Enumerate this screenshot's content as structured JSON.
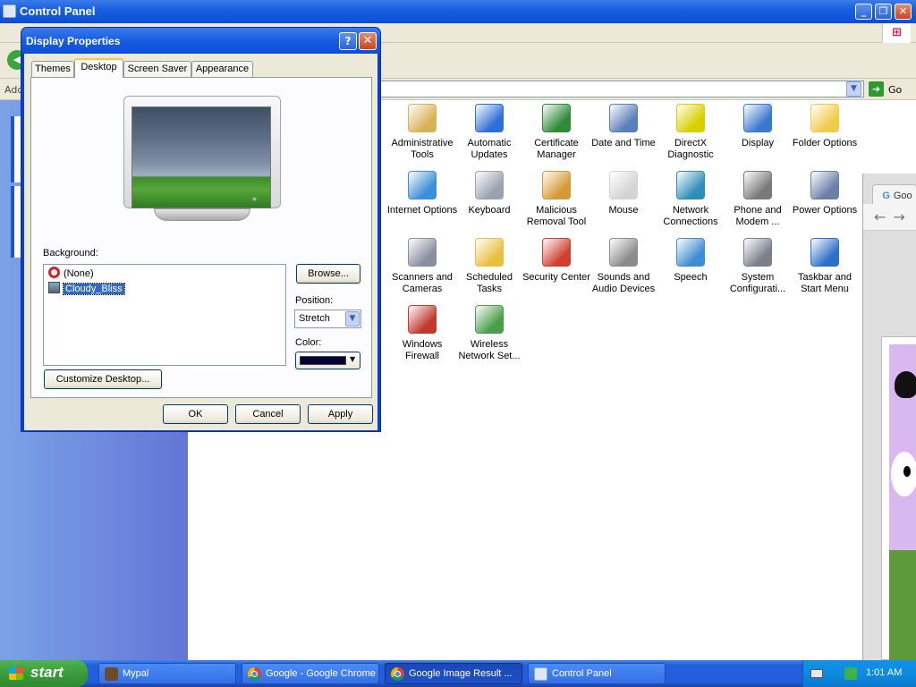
{
  "control_panel": {
    "title": "Control Panel",
    "address_label": "Add",
    "go_label": "Go",
    "items": [
      {
        "label": "Administrative Tools",
        "icon": "administrative-tools-icon",
        "color": "#d8b258"
      },
      {
        "label": "Automatic Updates",
        "icon": "automatic-updates-icon",
        "color": "#2e6fd6"
      },
      {
        "label": "Certificate Manager",
        "icon": "certificate-icon",
        "color": "#2f8a3a"
      },
      {
        "label": "Date and Time",
        "icon": "clock-icon",
        "color": "#5b7fb8"
      },
      {
        "label": "DirectX Diagnostic",
        "icon": "directx-icon",
        "color": "#d7d000"
      },
      {
        "label": "Display",
        "icon": "display-icon",
        "color": "#3a78d0"
      },
      {
        "label": "Folder Options",
        "icon": "folder-icon",
        "color": "#f0cb4c"
      },
      {
        "label": "Internet Options",
        "icon": "internet-options-icon",
        "color": "#3b8fd8"
      },
      {
        "label": "Keyboard",
        "icon": "keyboard-icon",
        "color": "#9aa2b0"
      },
      {
        "label": "Malicious Removal Tool",
        "icon": "malicious-removal-icon",
        "color": "#d59a36"
      },
      {
        "label": "Mouse",
        "icon": "mouse-icon",
        "color": "#d4d4d4"
      },
      {
        "label": "Network Connections",
        "icon": "network-icon",
        "color": "#2f8fb8"
      },
      {
        "label": "Phone and Modem ...",
        "icon": "phone-modem-icon",
        "color": "#7a7a7a"
      },
      {
        "label": "Power Options",
        "icon": "power-options-icon",
        "color": "#6b7fa8"
      },
      {
        "label": "Scanners and Cameras",
        "icon": "scanner-icon",
        "color": "#8a8fa0"
      },
      {
        "label": "Scheduled Tasks",
        "icon": "scheduled-tasks-icon",
        "color": "#e8c040"
      },
      {
        "label": "Security Center",
        "icon": "security-shield-icon",
        "color": "#d04030"
      },
      {
        "label": "Sounds and Audio Devices",
        "icon": "speaker-icon",
        "color": "#8c8c8c"
      },
      {
        "label": "Speech",
        "icon": "speech-icon",
        "color": "#3f8fd0"
      },
      {
        "label": "System Configurati...",
        "icon": "system-icon",
        "color": "#7a7f8a"
      },
      {
        "label": "Taskbar and Start Menu",
        "icon": "taskbar-icon",
        "color": "#2f6fc8"
      },
      {
        "label": "Windows Firewall",
        "icon": "firewall-icon",
        "color": "#c0392b"
      },
      {
        "label": "Wireless Network Set...",
        "icon": "wireless-icon",
        "color": "#4aa04a"
      }
    ]
  },
  "dialog": {
    "title": "Display Properties",
    "help_label": "?",
    "close_label": "✕",
    "tabs": [
      {
        "label": "Themes",
        "active": false
      },
      {
        "label": "Desktop",
        "active": true
      },
      {
        "label": "Screen Saver",
        "active": false
      },
      {
        "label": "Appearance",
        "active": false
      }
    ],
    "background_label": "Background:",
    "background_items": [
      {
        "label": "(None)",
        "icon": "none-icon",
        "selected": false
      },
      {
        "label": "Cloudy_Bliss",
        "icon": "image-file-icon",
        "selected": true
      }
    ],
    "browse_label": "Browse...",
    "position_label": "Position:",
    "position_value": "Stretch",
    "color_label": "Color:",
    "color_value": "#000033",
    "customize_label": "Customize Desktop...",
    "ok_label": "OK",
    "cancel_label": "Cancel",
    "apply_label": "Apply"
  },
  "chrome": {
    "tab_label": "Goo"
  },
  "taskbar": {
    "start_label": "start",
    "tasks": [
      {
        "label": "Mypal",
        "icon": "mypal-icon",
        "active": false
      },
      {
        "label": "Google - Google Chrome",
        "icon": "chrome-icon",
        "active": false
      },
      {
        "label": "Google Image Result ...",
        "icon": "chrome-icon",
        "active": true
      },
      {
        "label": "Control Panel",
        "icon": "control-panel-icon",
        "active": false
      }
    ],
    "clock": "1:01 AM"
  }
}
